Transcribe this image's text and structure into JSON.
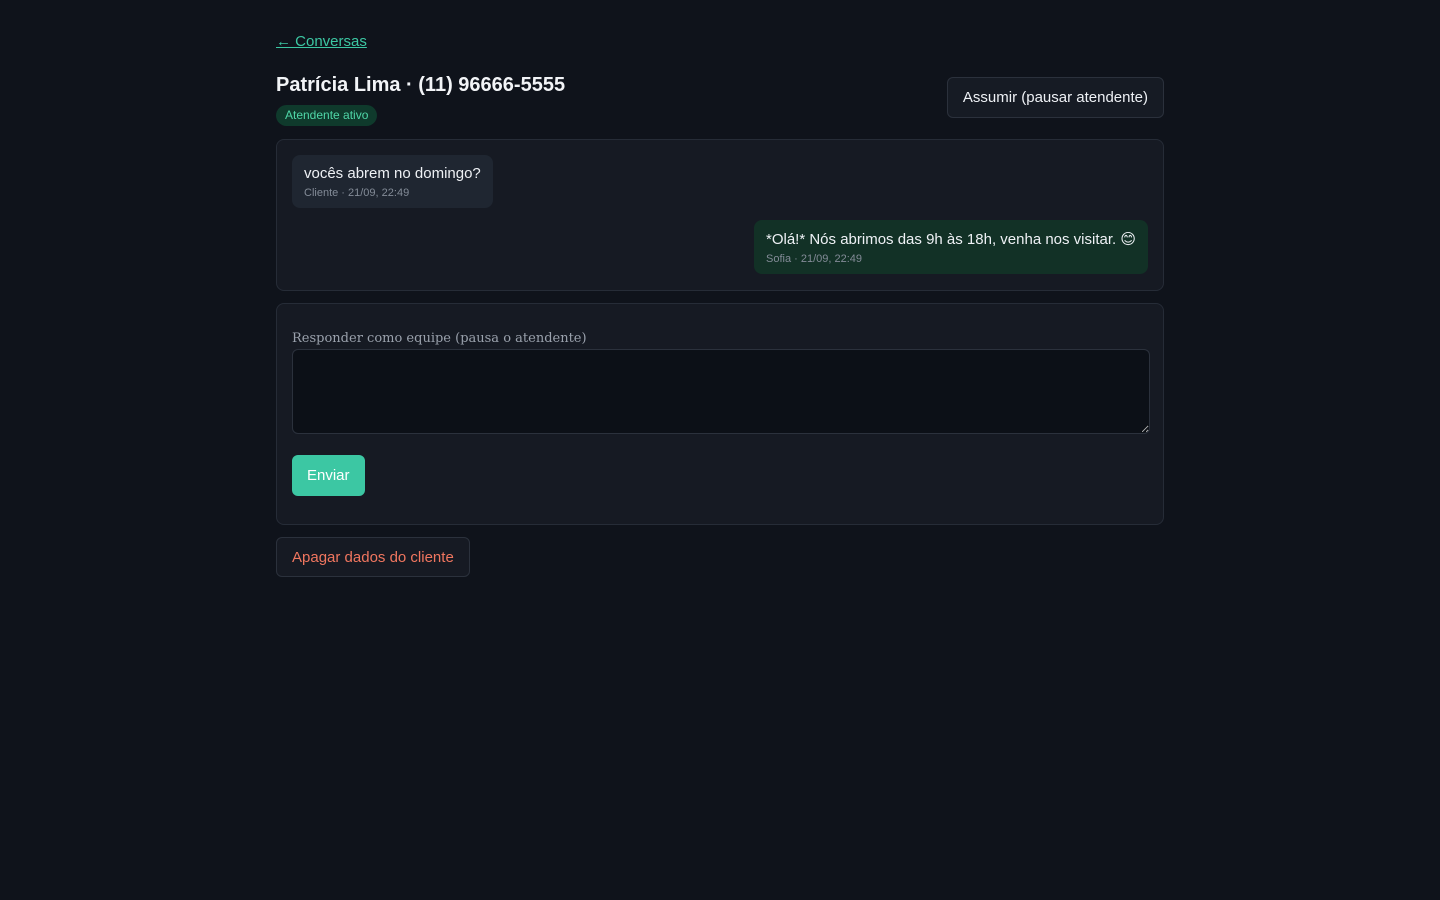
{
  "nav": {
    "back_link": "← Conversas"
  },
  "header": {
    "title": "Patrícia Lima · (11) 96666-5555",
    "status_badge": "Atendente ativo",
    "takeover_button": "Assumir (pausar atendente)"
  },
  "thread": {
    "messages": [
      {
        "direction": "incoming",
        "text": "vocês abrem no domingo?",
        "meta": "Cliente · 21/09, 22:49"
      },
      {
        "direction": "outgoing",
        "text": "*Olá!* Nós abrimos das 9h às 18h, venha nos visitar. 😊",
        "meta": "Sofia · 21/09, 22:49"
      }
    ]
  },
  "reply": {
    "label": "Responder como equipe (pausa o atendente)",
    "value": "",
    "placeholder": "",
    "send_button": "Enviar"
  },
  "actions": {
    "delete_button": "Apagar dados do cliente"
  },
  "colors": {
    "background": "#0f131b",
    "card": "#161a23",
    "accent": "#3cc7a3",
    "danger": "#f0765f",
    "outgoing_bubble": "#123126",
    "incoming_bubble": "#1f2631"
  }
}
